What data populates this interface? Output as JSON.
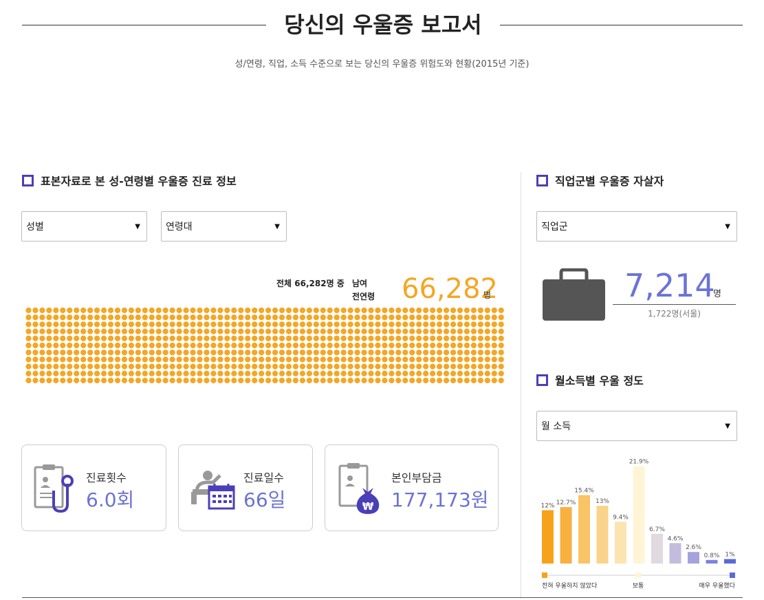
{
  "header": {
    "title": "당신의 우울증 보고서",
    "subtitle": "성/연령, 직업, 소득 수준으로 보는 당신의 우울증 위험도와 현황(2015년 기준)"
  },
  "sample_section": {
    "heading": "표본자료로 본 성-연령별 우울증 진료 정보",
    "gender_select": "성별",
    "age_select": "연령대",
    "total_label": "전체 66,282명 중",
    "group_line1": "남여",
    "group_line2": "전연령",
    "count": "66,282",
    "count_unit": "명",
    "dot_color": "#f5a623"
  },
  "cards": [
    {
      "label": "진료횟수",
      "value": "6.0회",
      "icon": "stethoscope-clipboard-icon"
    },
    {
      "label": "진료일수",
      "value": "66일",
      "icon": "patient-calendar-icon"
    },
    {
      "label": "본인부담금",
      "value": "177,173원",
      "icon": "money-bag-won-icon"
    }
  ],
  "job_section": {
    "heading": "직업군별 우울증 자살자",
    "select": "직업군",
    "count": "7,214",
    "unit": "명",
    "sub": "1,722명(서울)",
    "icon": "briefcase-icon"
  },
  "income_section": {
    "heading": "월소득별 우울 정도",
    "select": "월 소득",
    "legend_left": "전혀 우울하지 않았다",
    "legend_mid": "보통",
    "legend_right": "매우 우울했다"
  },
  "chart_data": {
    "type": "bar",
    "title": "",
    "categories": [
      "",
      "",
      "",
      "",
      "",
      "",
      "",
      "",
      "",
      "",
      ""
    ],
    "series": [
      {
        "values": [
          12,
          12.7,
          15.4,
          13,
          9.4,
          21.9,
          6.7,
          4.6,
          2.6,
          0.8,
          1
        ]
      }
    ],
    "labels": [
      "12%",
      "12.7%",
      "15.4%",
      "13%",
      "9.4%",
      "21.9%",
      "6.7%",
      "4.6%",
      "2.6%",
      "0.8%",
      "1%"
    ],
    "colors": [
      "#f7a21b",
      "#f8b041",
      "#f9c366",
      "#fad38b",
      "#fce4b0",
      "#fff4d6",
      "#e0d9df",
      "#c3bcdd",
      "#a6a2dd",
      "#7f82de",
      "#5c6ad8"
    ],
    "ylim": [
      0,
      22
    ],
    "grid": false,
    "legend": "bottom"
  }
}
